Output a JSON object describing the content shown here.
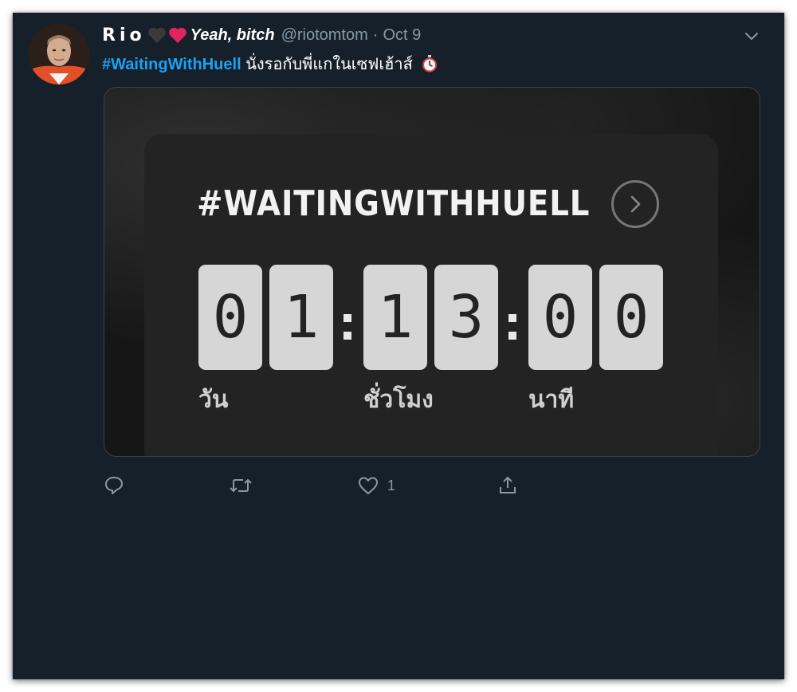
{
  "tweet": {
    "author": {
      "name": "Rio",
      "name_suffix": "Yeah, bitch",
      "handle": "@riotomtom",
      "avatar_icon": "profile-photo"
    },
    "separator": "·",
    "date": "Oct 9",
    "hashtag": "#WaitingWithHuell",
    "text": "นั่งรอกับพี่แกในเซฟเฮ้าส์",
    "menu_icon": "chevron-down-icon",
    "colors": {
      "background": "#15202b",
      "link": "#1da1f2",
      "muted": "#8899a6",
      "heart_red": "#e0245e",
      "heart_black": "#3a3a3a"
    }
  },
  "media": {
    "title": "#WAITINGWITHHUELL",
    "next_icon": "chevron-right-circle-icon",
    "digits": {
      "d1": "0",
      "d2": "1",
      "h1": "1",
      "h2": "3",
      "m1": "0",
      "m2": "0"
    },
    "labels": {
      "days": "วัน",
      "hours": "ชั่วโมง",
      "minutes": "นาที"
    }
  },
  "actions": {
    "reply_icon": "reply-icon",
    "retweet_icon": "retweet-icon",
    "like_icon": "heart-icon",
    "like_count": "1",
    "share_icon": "share-icon"
  }
}
